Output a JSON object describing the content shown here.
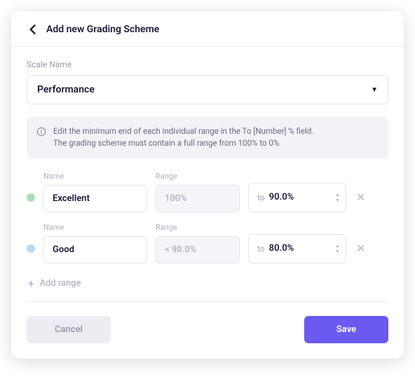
{
  "header": {
    "title": "Add new Grading Scheme"
  },
  "scale": {
    "label": "Scale Name",
    "value": "Performance"
  },
  "info": {
    "line1": "Edit the minimum end of each individual range in the To [Number] % field.",
    "line2": "The grading scheme must contain a full range from 100% to 0%"
  },
  "labels": {
    "name": "Name",
    "range": "Range",
    "to": "to",
    "add_range": "Add range"
  },
  "rows": [
    {
      "color": "#a5e0bd",
      "name": "Excellent",
      "range": "100%",
      "to": "90.0%"
    },
    {
      "color": "#b9d9f2",
      "name": "Good",
      "range": "< 90.0%",
      "to": "80.0%"
    }
  ],
  "footer": {
    "cancel": "Cancel",
    "save": "Save"
  }
}
